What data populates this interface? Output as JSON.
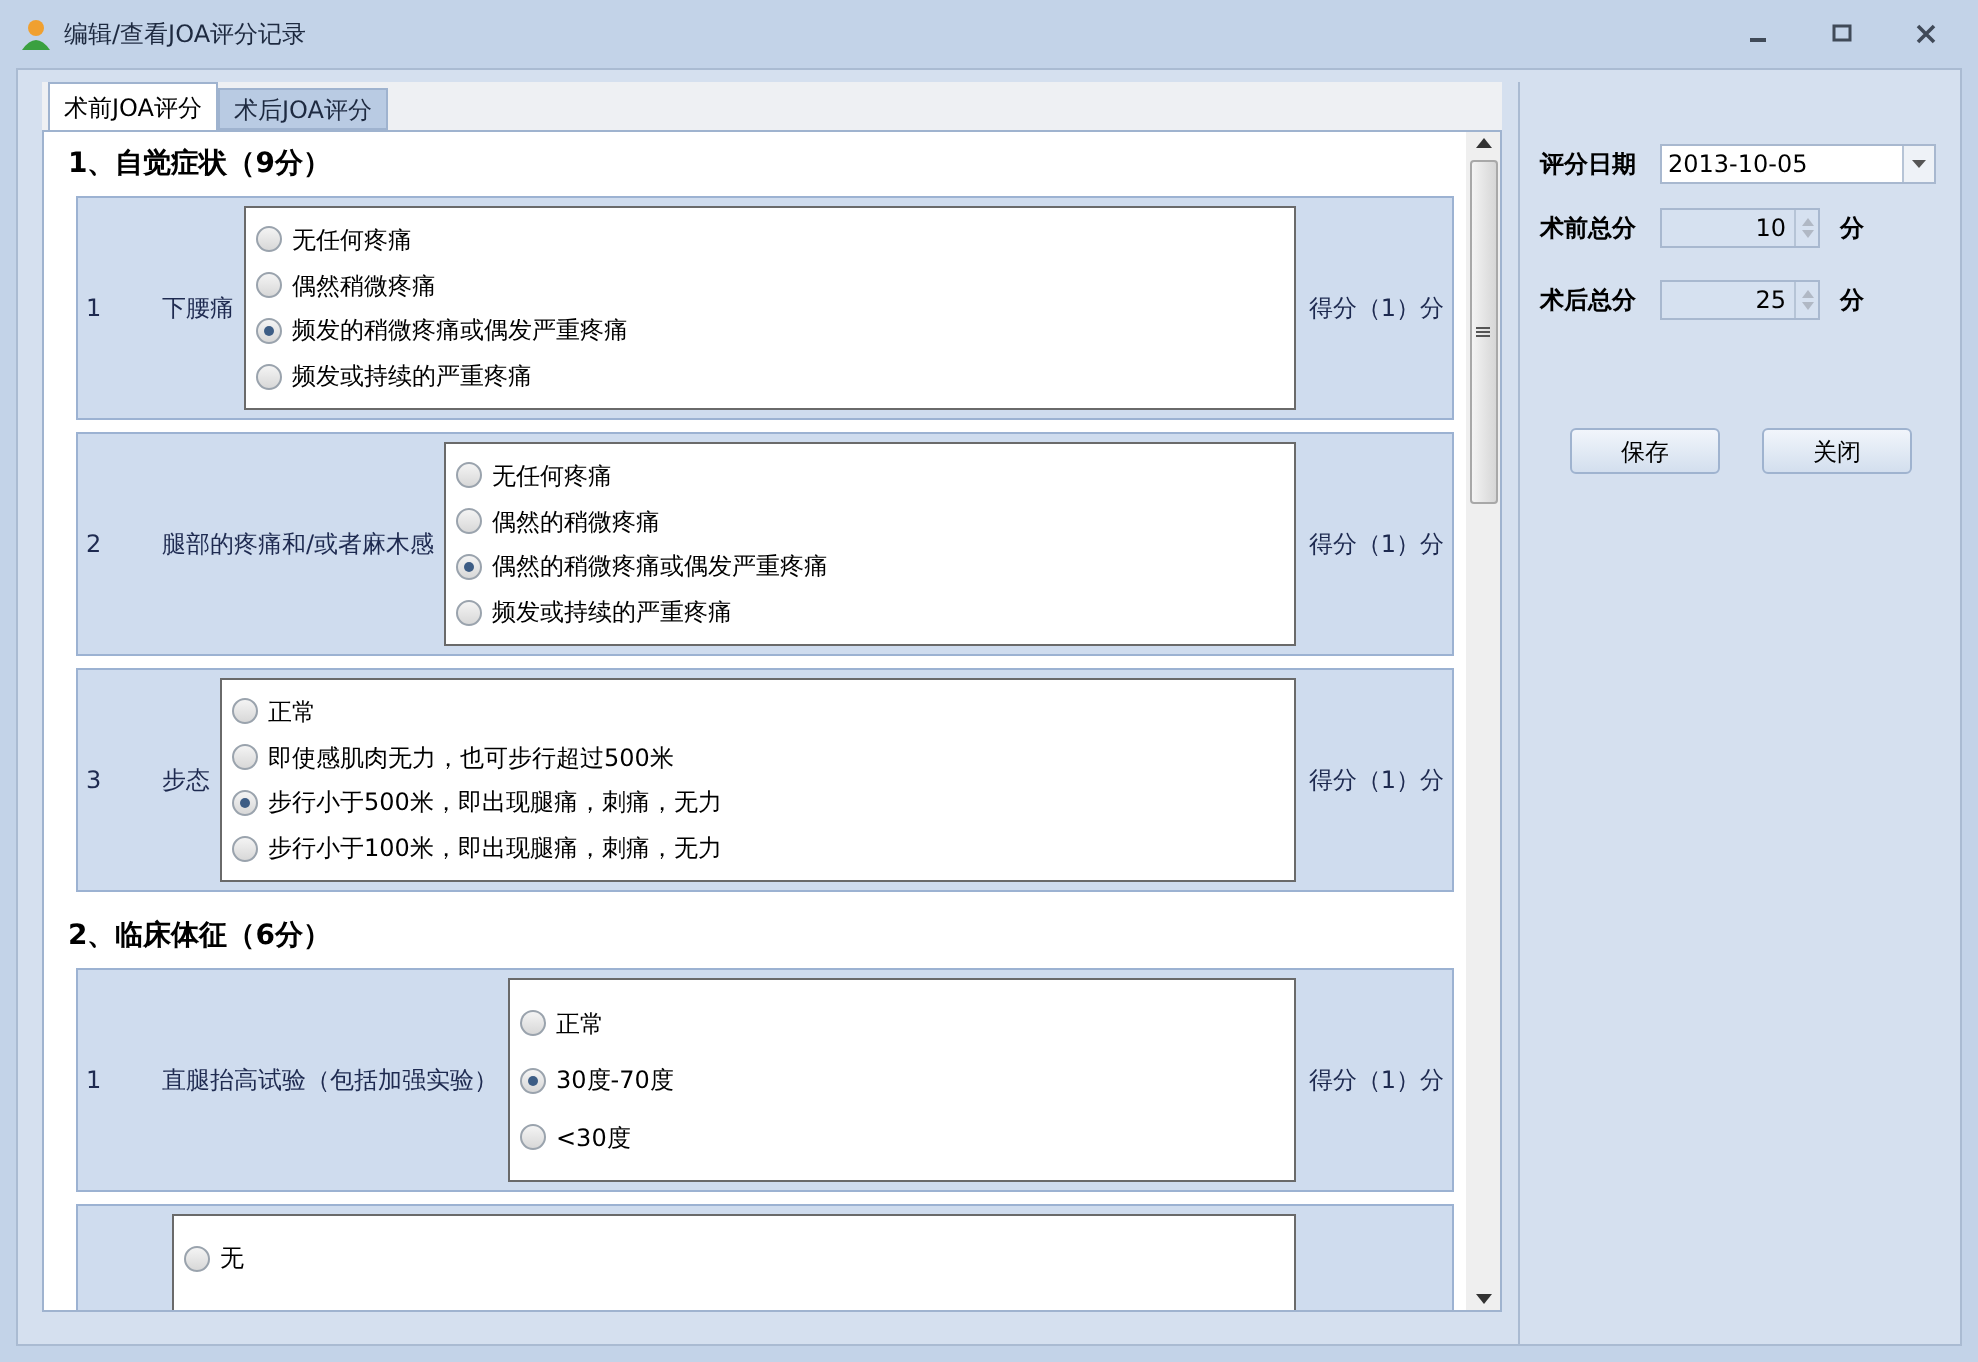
{
  "window": {
    "title": "编辑/查看JOA评分记录"
  },
  "tabs": [
    {
      "label": "术前JOA评分",
      "selected": true
    },
    {
      "label": "术后JOA评分",
      "selected": false
    }
  ],
  "sections": [
    {
      "title": "1、自觉症状（9分）",
      "items": [
        {
          "number": "1",
          "label": "下腰痛",
          "score": "得分（1）分",
          "options": [
            {
              "label": "无任何疼痛",
              "selected": false
            },
            {
              "label": "偶然稍微疼痛",
              "selected": false
            },
            {
              "label": "频发的稍微疼痛或偶发严重疼痛",
              "selected": true
            },
            {
              "label": "频发或持续的严重疼痛",
              "selected": false
            }
          ]
        },
        {
          "number": "2",
          "label": "腿部的疼痛和/或者麻木感",
          "score": "得分（1）分",
          "options": [
            {
              "label": "无任何疼痛",
              "selected": false
            },
            {
              "label": "偶然的稍微疼痛",
              "selected": false
            },
            {
              "label": "偶然的稍微疼痛或偶发严重疼痛",
              "selected": true
            },
            {
              "label": "频发或持续的严重疼痛",
              "selected": false
            }
          ]
        },
        {
          "number": "3",
          "label": "步态",
          "score": "得分（1）分",
          "options": [
            {
              "label": "正常",
              "selected": false
            },
            {
              "label": "即使感肌肉无力，也可步行超过500米",
              "selected": false
            },
            {
              "label": "步行小于500米，即出现腿痛，刺痛，无力",
              "selected": true
            },
            {
              "label": "步行小于100米，即出现腿痛，刺痛，无力",
              "selected": false
            }
          ]
        }
      ]
    },
    {
      "title": "2、临床体征（6分）",
      "items": [
        {
          "number": "1",
          "label": "直腿抬高试验（包括加强实验）",
          "score": "得分（1）分",
          "options": [
            {
              "label": "正常",
              "selected": false
            },
            {
              "label": "30度-70度",
              "selected": true
            },
            {
              "label": "<30度",
              "selected": false
            }
          ]
        },
        {
          "options": [
            {
              "label": "无",
              "selected": false
            }
          ]
        }
      ]
    }
  ],
  "form": {
    "date_label": "评分日期",
    "date": "2013-10-05",
    "pre_label": "术前总分",
    "pre_value": "10",
    "pre_unit": "分",
    "post_label": "术后总分",
    "post_value": "25",
    "post_unit": "分"
  },
  "buttons": [
    "保存",
    "关闭"
  ]
}
